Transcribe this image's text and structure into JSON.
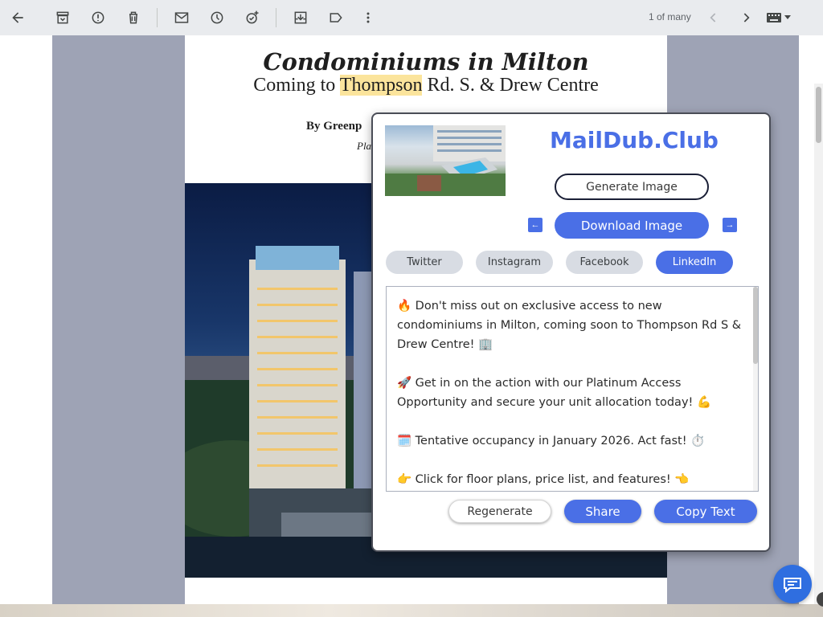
{
  "toolbar": {
    "icons": [
      "back-arrow-icon",
      "archive-icon",
      "report-spam-icon",
      "delete-icon",
      "mark-unread-icon",
      "snooze-icon",
      "add-task-icon",
      "move-to-icon",
      "label-icon",
      "more-vert-icon"
    ],
    "pager_text": "1 of many"
  },
  "email": {
    "title": "Condominiums in Milton",
    "subtitle_before": "Coming to ",
    "subtitle_highlight": "Thompson",
    "subtitle_after": " Rd. S. & Drew Centre",
    "byline_visible": "By Greenp",
    "byline2_visible": "Pla"
  },
  "popup": {
    "brand": "MailDub.Club",
    "generate_label": "Generate Image",
    "download_label": "Download Image",
    "prev_arrow": "←",
    "next_arrow": "→",
    "tabs": [
      {
        "label": "Twitter",
        "active": false
      },
      {
        "label": "Instagram",
        "active": false
      },
      {
        "label": "Facebook",
        "active": false
      },
      {
        "label": "LinkedIn",
        "active": true
      }
    ],
    "post_paragraphs": [
      "🔥 Don't miss out on exclusive access to new condominiums in Milton, coming soon to Thompson Rd S & Drew Centre! 🏢",
      "🚀 Get in on the action with our Platinum Access Opportunity and secure your unit allocation today! 💪",
      "🗓️ Tentative occupancy in January 2026. Act fast! ⏱️",
      "👉 Click for floor plans, price list, and features! 👈"
    ],
    "regenerate_label": "Regenerate",
    "share_label": "Share",
    "copy_label": "Copy Text"
  },
  "colors": {
    "accent": "#4a6fe6",
    "highlight": "#fbe49c",
    "email_frame": "#9ea3b5"
  }
}
